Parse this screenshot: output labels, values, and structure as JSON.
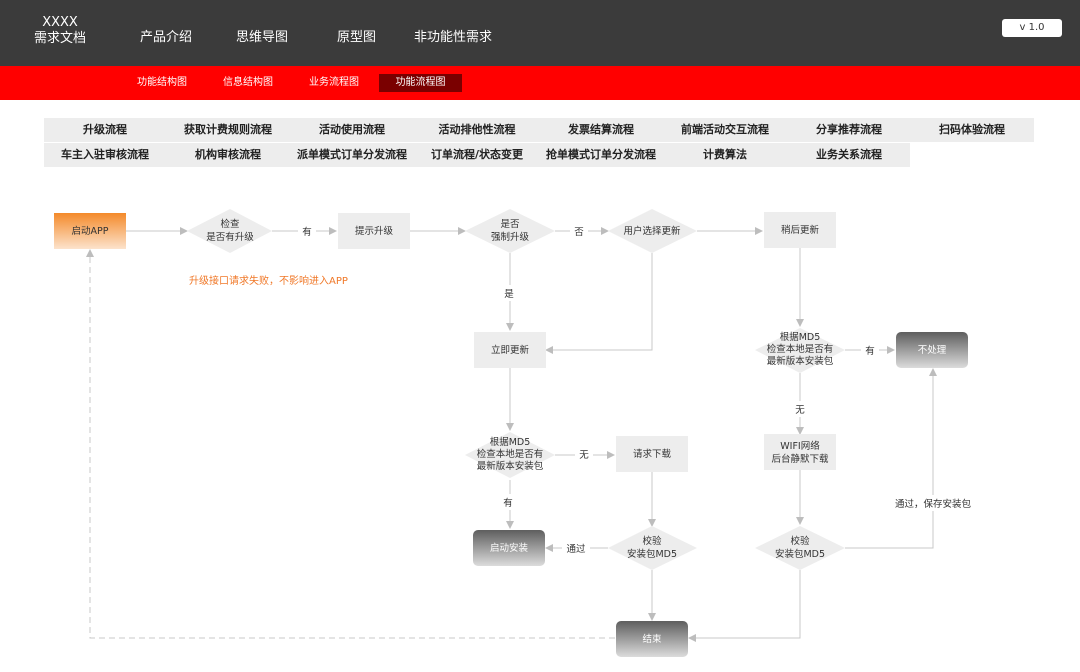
{
  "header": {
    "logo_line1": "XXXX",
    "logo_line2": "需求文档",
    "nav": [
      "产品介绍",
      "思维导图",
      "原型图",
      "非功能性需求"
    ],
    "version": "v 1.0"
  },
  "subnav": {
    "items": [
      "功能结构图",
      "信息结构图",
      "业务流程图",
      "功能流程图"
    ],
    "active": "功能流程图"
  },
  "flow_tabs": {
    "row1": [
      "升级流程",
      "获取计费规则流程",
      "活动使用流程",
      "活动排他性流程",
      "发票结算流程",
      "前端活动交互流程",
      "分享推荐流程",
      "扫码体验流程"
    ],
    "row2": [
      "车主入驻审核流程",
      "机构审核流程",
      "派单模式订单分发流程",
      "订单流程/状态变更",
      "抢单模式订单分发流程",
      "计费算法",
      "业务关系流程"
    ]
  },
  "diagram": {
    "nodes": {
      "start_app": "启动APP",
      "check_upgrade": [
        "检查",
        "是否有升级"
      ],
      "prompt_upgrade": "提示升级",
      "force_upgrade": [
        "是否",
        "强制升级"
      ],
      "user_choose": "用户选择更新",
      "later_update": "稍后更新",
      "update_now": "立即更新",
      "md5_check_left": [
        "根据MD5",
        "检查本地是否有",
        "最新版本安装包"
      ],
      "md5_check_right": [
        "根据MD5",
        "检查本地是否有",
        "最新版本安装包"
      ],
      "no_process": "不处理",
      "request_download": "请求下载",
      "wifi_download": [
        "WIFI网络",
        "后台静默下载"
      ],
      "launch_install": "启动安装",
      "verify_left": [
        "校验",
        "安装包MD5"
      ],
      "verify_right": [
        "校验",
        "安装包MD5"
      ],
      "end": "结束"
    },
    "edges": {
      "has": "有",
      "no": "否",
      "yes": "是",
      "none": "无",
      "pass": "通过",
      "pass_save": "通过，保存安装包"
    },
    "note": "升级接口请求失败，不影响进入APP",
    "colors": {
      "start_fill": "#f48a2a",
      "node_fill": "#ededed",
      "dark_node": "#6f6f6f",
      "line": "#c8c8c8",
      "note": "#f07828"
    }
  }
}
